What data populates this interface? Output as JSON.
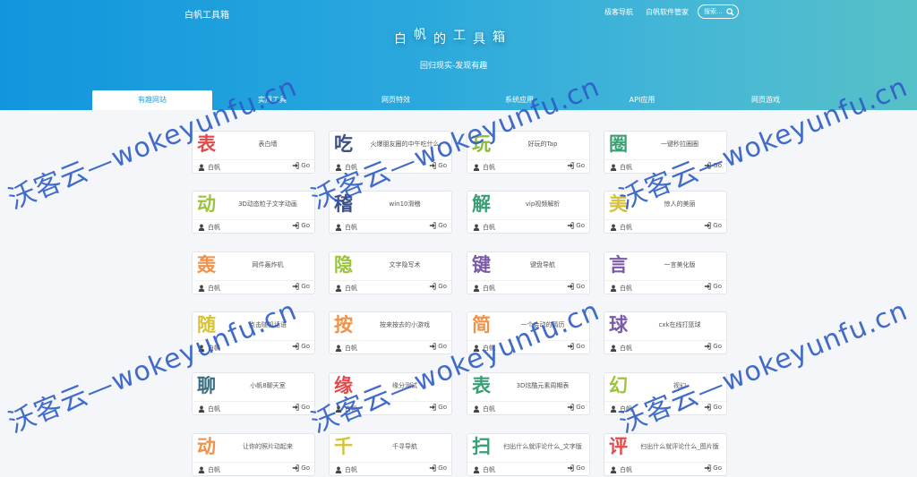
{
  "header": {
    "brand": "白帆工具箱",
    "nav": [
      "极客导航",
      "白帆软件管家"
    ],
    "search_placeholder": "搜索...",
    "banner_chars": [
      "白",
      "帆",
      "的",
      "工",
      "具",
      "箱"
    ],
    "subtitle": "回归现实-发现有趣"
  },
  "tabs": [
    "有趣网站",
    "实用工具",
    "网页特效",
    "系统应用",
    "API应用",
    "网页游戏"
  ],
  "cards": [
    {
      "char": "表",
      "color": "#e5494a",
      "desc": "表白墙",
      "author": "白帆",
      "go": "Go"
    },
    {
      "char": "吃",
      "color": "#3c4f86",
      "desc": "火爆朋友圈的中午吃什么",
      "author": "白帆",
      "go": "Go"
    },
    {
      "char": "玩",
      "color": "#8bbb3a",
      "desc": "好玩的Tap",
      "author": "白帆",
      "go": "Go"
    },
    {
      "char": "圈",
      "color": "#3aa074",
      "desc": "一键秒拉圈圈",
      "author": "白帆",
      "go": "Go"
    },
    {
      "char": "动",
      "color": "#9bc43c",
      "desc": "3D动态粒子文字动画",
      "author": "白帆",
      "go": "Go"
    },
    {
      "char": "稽",
      "color": "#3c4f86",
      "desc": "win10滑稽",
      "author": "白帆",
      "go": "Go"
    },
    {
      "char": "解",
      "color": "#3aa074",
      "desc": "vip视频解析",
      "author": "白帆",
      "go": "Go"
    },
    {
      "char": "美",
      "color": "#d6c237",
      "desc": "惊人的美丽",
      "author": "白帆",
      "go": "Go"
    },
    {
      "char": "轰",
      "color": "#f0924a",
      "desc": "网件轰炸机",
      "author": "白帆",
      "go": "Go"
    },
    {
      "char": "隐",
      "color": "#9bc43c",
      "desc": "文字隐写术",
      "author": "白帆",
      "go": "Go"
    },
    {
      "char": "键",
      "color": "#7a5aa8",
      "desc": "键盘导航",
      "author": "白帆",
      "go": "Go"
    },
    {
      "char": "言",
      "color": "#7a5aa8",
      "desc": "一言美化版",
      "author": "白帆",
      "go": "Go"
    },
    {
      "char": "随",
      "color": "#d6c237",
      "desc": "点击随机话语",
      "author": "白帆",
      "go": "Go"
    },
    {
      "char": "按",
      "color": "#f0924a",
      "desc": "按来按去的小游戏",
      "author": "白帆",
      "go": "Go"
    },
    {
      "char": "简",
      "color": "#f0924a",
      "desc": "一个会动的简历",
      "author": "白帆",
      "go": "Go"
    },
    {
      "char": "球",
      "color": "#7a5aa8",
      "desc": "cxk在线打篮球",
      "author": "白帆",
      "go": "Go"
    },
    {
      "char": "聊",
      "color": "#3a6e80",
      "desc": "小帆8聊天室",
      "author": "白帆",
      "go": "Go"
    },
    {
      "char": "缘",
      "color": "#e5494a",
      "desc": "缘分测试",
      "author": "白帆",
      "go": "Go"
    },
    {
      "char": "表",
      "color": "#3aa074",
      "desc": "3D炫酷元素周期表",
      "author": "白帆",
      "go": "Go"
    },
    {
      "char": "幻",
      "color": "#9bc43c",
      "desc": "视幻",
      "author": "白帆",
      "go": "Go"
    },
    {
      "char": "动",
      "color": "#f0924a",
      "desc": "让你的照片动起来",
      "author": "白帆",
      "go": "Go"
    },
    {
      "char": "千",
      "color": "#d6c237",
      "desc": "千寻导航",
      "author": "白帆",
      "go": "Go"
    },
    {
      "char": "扫",
      "color": "#3aa074",
      "desc": "扫出什么就评论什么_文字版",
      "author": "白帆",
      "go": "Go"
    },
    {
      "char": "评",
      "color": "#e5494a",
      "desc": "扫出什么就评论什么_图片版",
      "author": "白帆",
      "go": "Go"
    }
  ],
  "watermark": "沃客云—wokeyunfu.cn",
  "colors": {
    "header_start": "#1196dd",
    "header_end": "#57c0c8",
    "active_tab_text": "#2a9fd8",
    "watermark": "#2d5cc6"
  }
}
